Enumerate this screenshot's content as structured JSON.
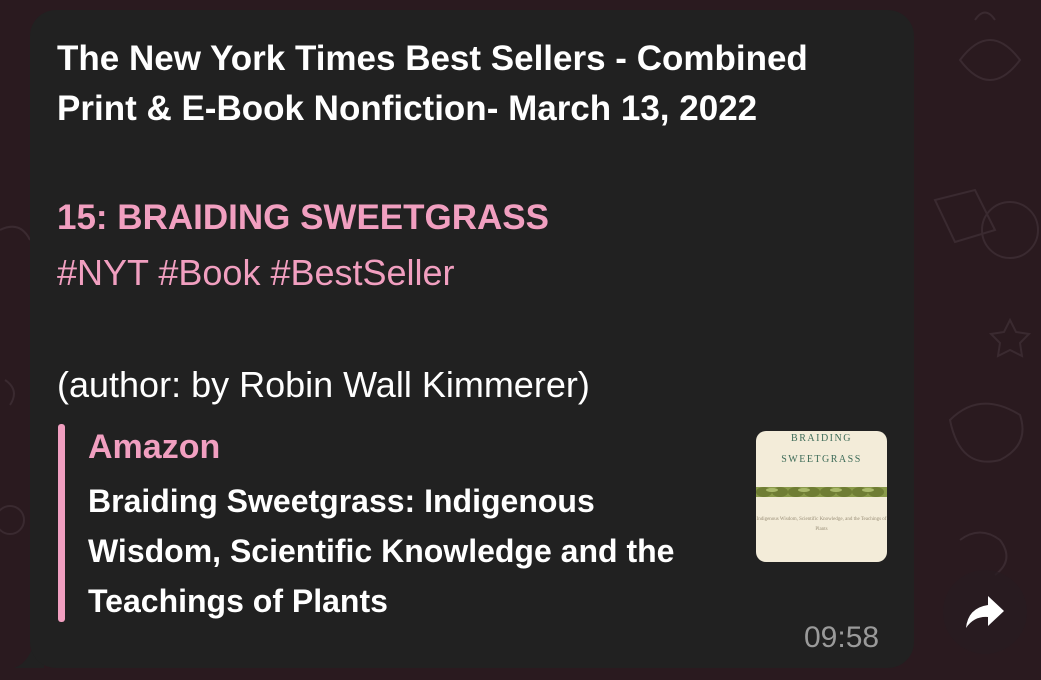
{
  "colors": {
    "wallpaper": "#2a1a1f",
    "bubble": "#212121",
    "accent": "#f19fc0",
    "text": "#ffffff",
    "meta": "#9a9a9a"
  },
  "message": {
    "title": "The New York Times Best Sellers - Combined Print & E-Book Nonfiction- March 13, 2022",
    "rank": "15: BRAIDING SWEETGRASS",
    "hashtags": "#NYT #Book #BestSeller",
    "author": "(author: by Robin Wall Kimmerer)",
    "time": "09:58"
  },
  "link_preview": {
    "site": "Amazon",
    "description": "Braiding Sweetgrass: Indigenous Wisdom, Scientific Knowledge and the Teachings of Plants",
    "thumbnail": {
      "title_line1": "BRAIDING",
      "title_line2": "SWEETGRASS",
      "subtitle": "Indigenous Wisdom, Scientific Knowledge, and the Teachings of Plants"
    }
  },
  "icons": {
    "share": "share-arrow-icon"
  }
}
